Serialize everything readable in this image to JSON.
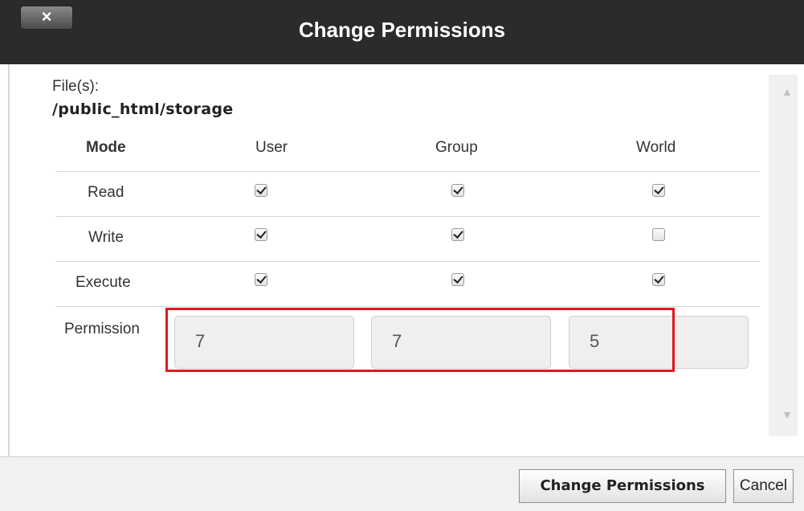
{
  "dialog": {
    "title": "Change Permissions",
    "close_label": "×"
  },
  "files": {
    "label": "File(s):",
    "path": "/public_html/storage"
  },
  "table": {
    "headers": [
      "Mode",
      "User",
      "Group",
      "World"
    ],
    "rows": [
      {
        "label": "Read",
        "user": true,
        "group": true,
        "world": true
      },
      {
        "label": "Write",
        "user": true,
        "group": true,
        "world": false
      },
      {
        "label": "Execute",
        "user": true,
        "group": true,
        "world": true
      }
    ],
    "permission_label": "Permission",
    "permission_values": [
      "7",
      "7",
      "5",
      ""
    ]
  },
  "footer": {
    "change_label": "Change Permissions",
    "cancel_label": "Cancel"
  },
  "colors": {
    "titlebar": "#2b2b2b",
    "highlight": "#e0171f"
  },
  "icons": {
    "close": "close-icon",
    "scroll_up": "scroll-up-arrow-icon",
    "scroll_down": "scroll-down-arrow-icon",
    "checkbox": "checkbox-icon"
  }
}
